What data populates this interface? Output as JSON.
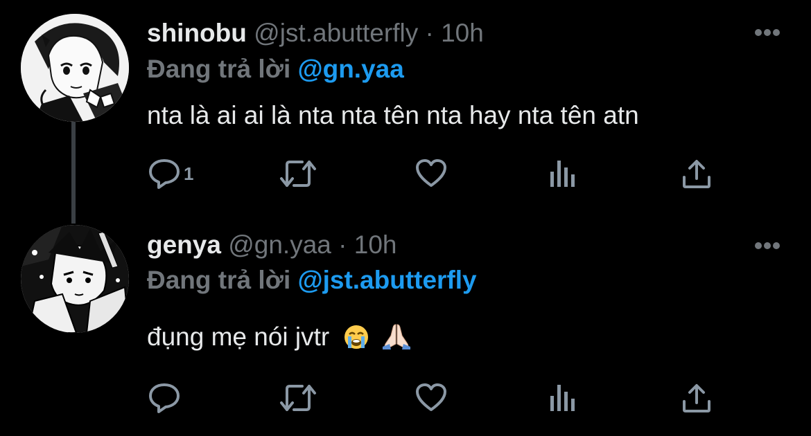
{
  "tweets": [
    {
      "name": "shinobu",
      "handle": "@jst.abutterfly",
      "dot": "·",
      "time": "10h",
      "replying_label": "Đang trả lời",
      "replying_to": "@gn.yaa",
      "text": "nta là ai ai là nta nta tên nta hay nta tên atn",
      "reply_count": "1"
    },
    {
      "name": "genya",
      "handle": "@gn.yaa",
      "dot": "·",
      "time": "10h",
      "replying_label": "Đang trả lời",
      "replying_to": "@jst.abutterfly",
      "text": "đụng mẹ nói jvtr",
      "emojis": [
        "loudly-crying-face",
        "folded-hands"
      ],
      "reply_count": ""
    }
  ],
  "colors": {
    "background": "#000000",
    "primary_text": "#e7e9ea",
    "secondary_text": "#71767b",
    "mention": "#1d9bf0",
    "icon": "#8b98a5"
  },
  "icons": [
    "avatar",
    "more-icon",
    "reply-icon",
    "retweet-icon",
    "like-icon",
    "views-icon",
    "share-icon"
  ]
}
